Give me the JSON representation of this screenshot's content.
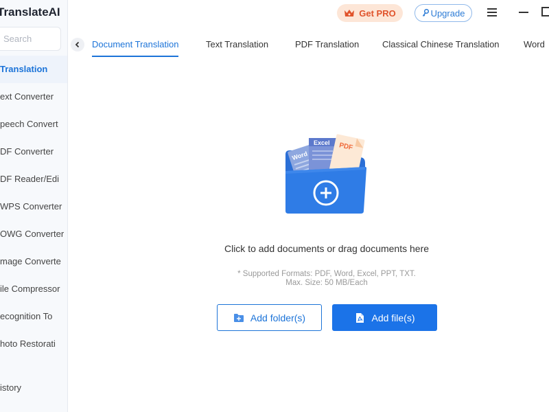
{
  "app": {
    "title": "TranslateAI"
  },
  "search": {
    "placeholder": "Search"
  },
  "sidebar": {
    "items": [
      {
        "label": "Translation",
        "active": true
      },
      {
        "label": "ext Converter"
      },
      {
        "label": "peech Convert"
      },
      {
        "label": "DF Converter"
      },
      {
        "label": "DF Reader/Edi"
      },
      {
        "label": "WPS Converter"
      },
      {
        "label": "OWG Converter"
      },
      {
        "label": "mage Converte"
      },
      {
        "label": "ile Compressor"
      },
      {
        "label": "ecognition To"
      },
      {
        "label": "hoto Restorati"
      }
    ],
    "history_label": "istory"
  },
  "topbar": {
    "get_pro_label": "Get PRO",
    "upgrade_label": "Upgrade",
    "accent_color": "#e0532b"
  },
  "tabs": [
    {
      "label": "Document Translation",
      "active": true
    },
    {
      "label": "Text Translation"
    },
    {
      "label": "PDF Translation"
    },
    {
      "label": "Classical Chinese Translation"
    },
    {
      "label": "Word"
    }
  ],
  "main": {
    "drop_text": "Click to add documents or drag documents here",
    "formats_line1": "* Supported Formats: PDF, Word, Excel, PPT, TXT.",
    "formats_line2": "Max. Size: 50 MB/Each",
    "add_folder_label": "Add folder(s)",
    "add_files_label": "Add file(s)",
    "illustration": {
      "doc_labels": [
        "Word",
        "Excel",
        "PDF"
      ]
    }
  },
  "colors": {
    "primary": "#1b73e8",
    "sidebar_bg": "#f7f9fc"
  }
}
